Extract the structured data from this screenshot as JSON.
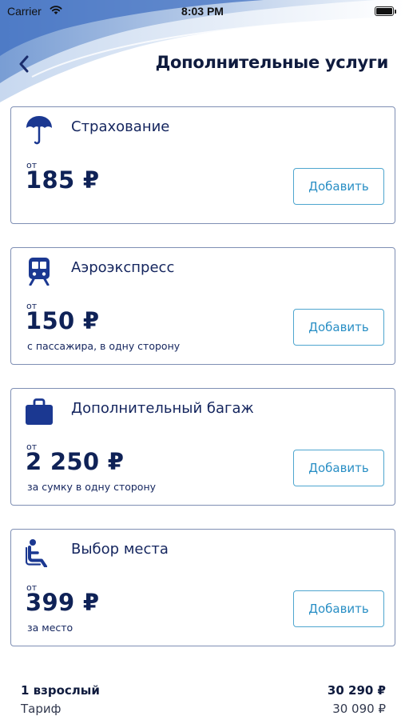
{
  "status_bar": {
    "carrier": "Carrier",
    "time": "8:03 PM"
  },
  "header": {
    "title": "Дополнительные услуги"
  },
  "services": [
    {
      "title": "Страхование",
      "from": "от",
      "price": "185 ₽",
      "note": "",
      "button": "Добавить",
      "icon": "umbrella-icon"
    },
    {
      "title": "Аэроэкспресс",
      "from": "от",
      "price": "150 ₽",
      "note": "с пассажира, в одну сторону",
      "button": "Добавить",
      "icon": "train-icon"
    },
    {
      "title": "Дополнительный багаж",
      "from": "от",
      "price": "2 250 ₽",
      "note": "за сумку в одну сторону",
      "button": "Добавить",
      "icon": "suitcase-icon"
    },
    {
      "title": "Выбор места",
      "from": "от",
      "price": "399 ₽",
      "note": "за место",
      "button": "Добавить",
      "icon": "seat-icon"
    }
  ],
  "summary": {
    "passengers_label": "1 взрослый",
    "passengers_total": "30 290 ₽",
    "fare_label": "Тариф",
    "fare_value": "30 090 ₽"
  },
  "colors": {
    "accent": "#2a8fc5",
    "brand": "#1b3891",
    "text": "#14255e"
  }
}
